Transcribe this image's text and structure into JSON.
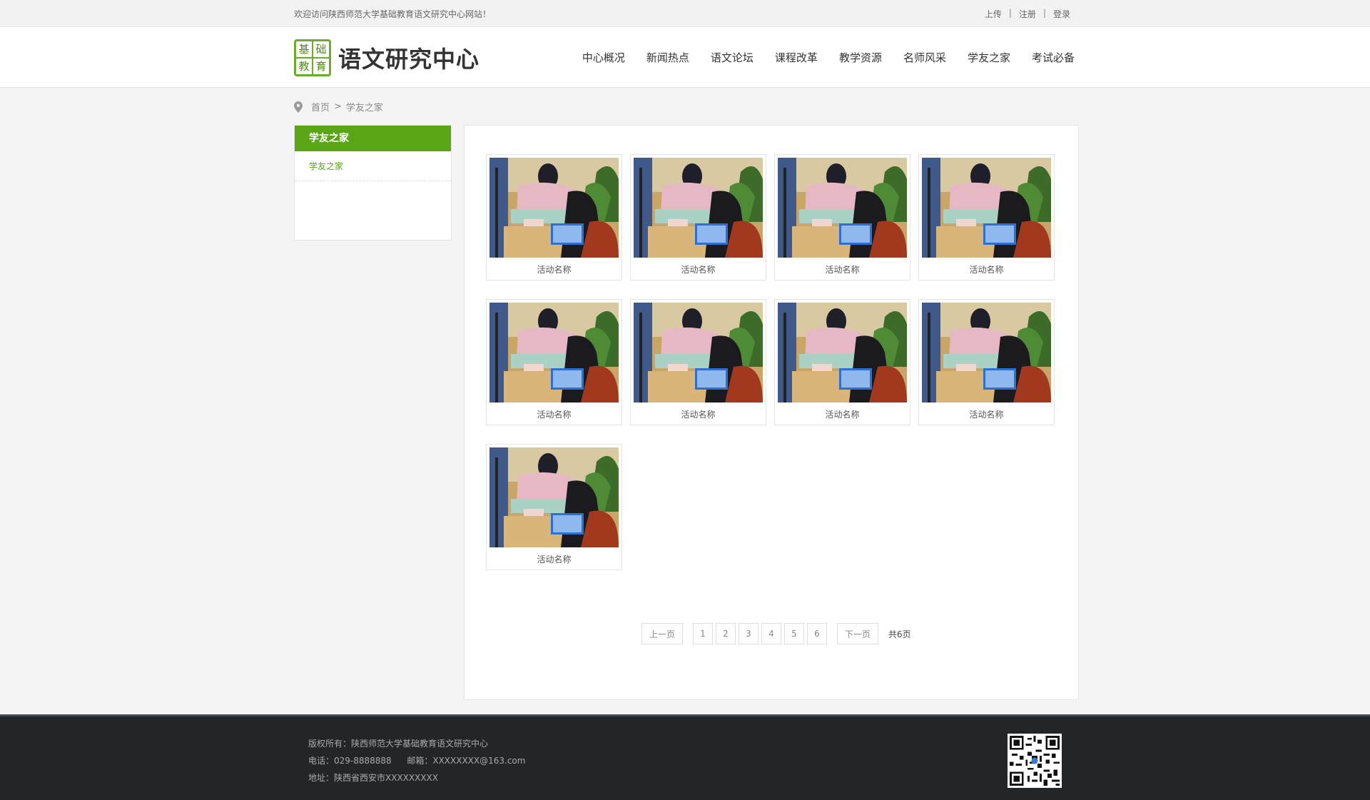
{
  "topbar": {
    "welcome": "欢迎访问陕西师范大学基础教育语文研究中心网站！",
    "links": [
      "上传",
      "注册",
      "登录"
    ],
    "separator": "|"
  },
  "logo": {
    "mark_chars": [
      "基",
      "础",
      "教",
      "育"
    ],
    "title": "语文研究中心"
  },
  "nav": [
    "中心概况",
    "新闻热点",
    "语文论坛",
    "课程改革",
    "教学资源",
    "名师风采",
    "学友之家",
    "考试必备"
  ],
  "breadcrumb": {
    "home": "首页",
    "sep": ">",
    "current": "学友之家"
  },
  "sidebar": {
    "title": "学友之家",
    "items": [
      "学友之家"
    ]
  },
  "gallery": {
    "items": [
      {
        "caption": "活动名称"
      },
      {
        "caption": "活动名称"
      },
      {
        "caption": "活动名称"
      },
      {
        "caption": "活动名称"
      },
      {
        "caption": "活动名称"
      },
      {
        "caption": "活动名称"
      },
      {
        "caption": "活动名称"
      },
      {
        "caption": "活动名称"
      },
      {
        "caption": "活动名称"
      }
    ]
  },
  "pagination": {
    "prev": "上一页",
    "pages": [
      "1",
      "2",
      "3",
      "4",
      "5",
      "6"
    ],
    "next": "下一页",
    "total": "共6页"
  },
  "footer": {
    "copyright": "版权所有：陕西师范大学基础教育语文研究中心",
    "phone": "电话：029-8888888",
    "email": "邮箱：XXXXXXXX@163.com",
    "address": "地址：陕西省西安市XXXXXXXXX"
  },
  "colors": {
    "accent": "#5aa516",
    "footer_bg": "#232628"
  }
}
